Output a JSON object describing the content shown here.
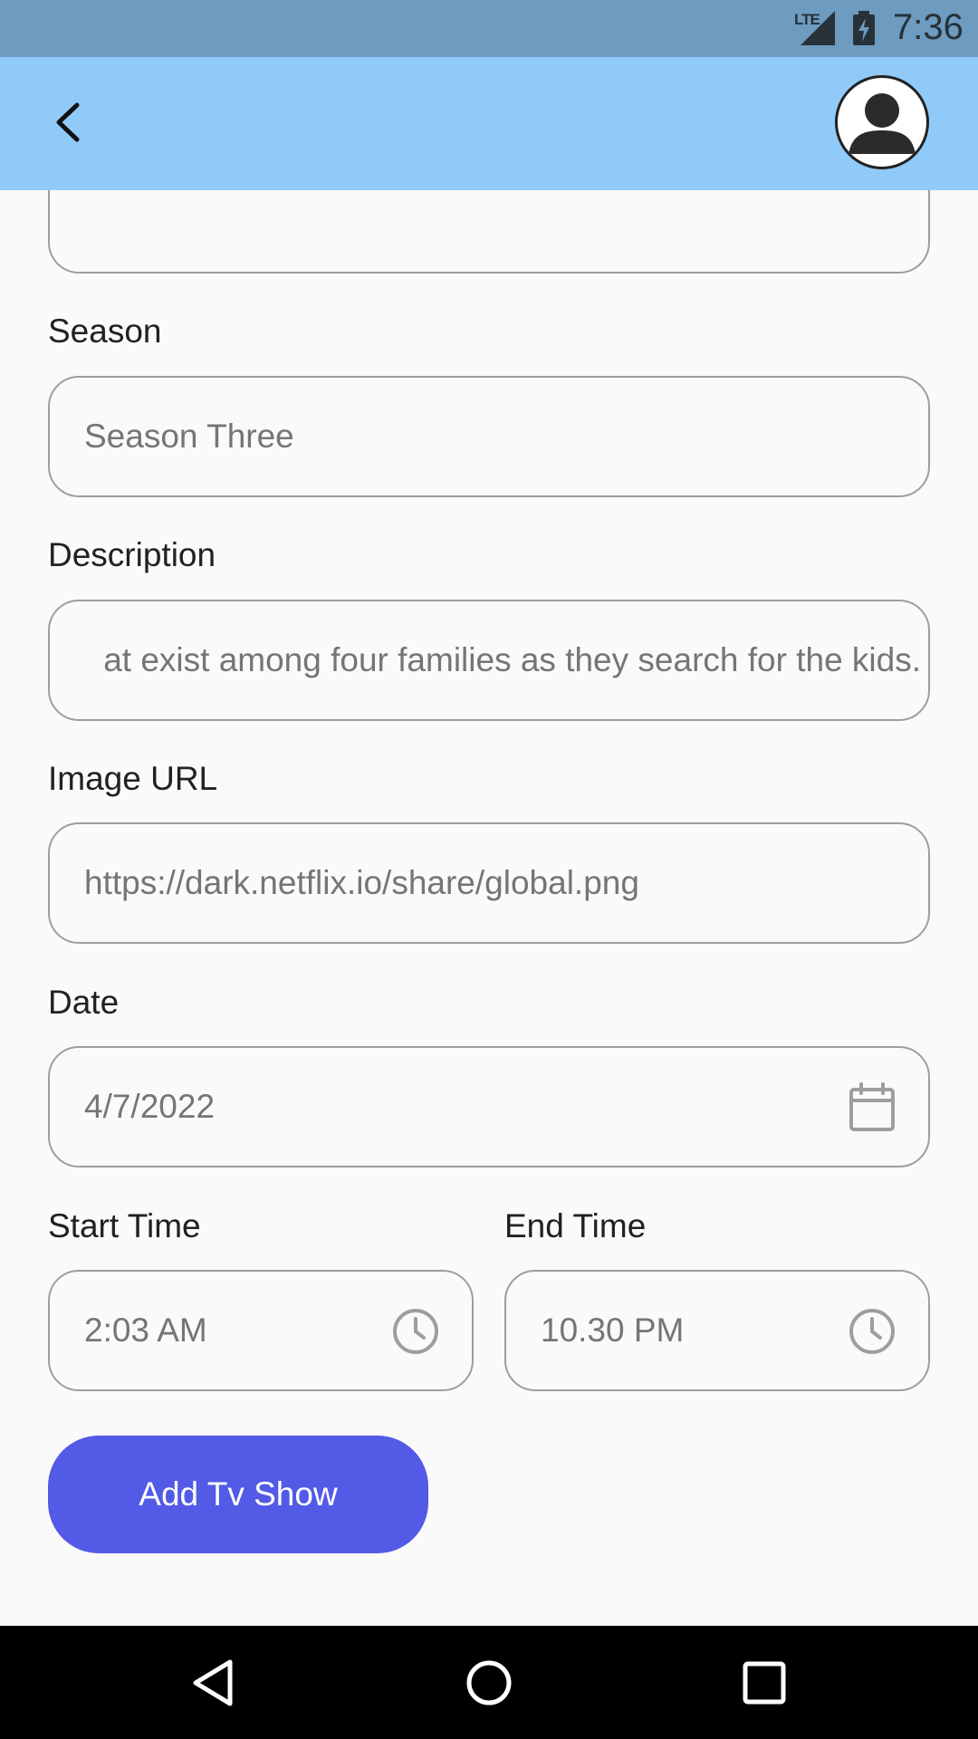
{
  "status_bar": {
    "network": "LTE",
    "time": "7:36"
  },
  "app_bar": {
    "back_icon": "chevron-left-icon",
    "avatar_icon": "account-circle-icon"
  },
  "form": {
    "season": {
      "label": "Season",
      "value": "Season Three"
    },
    "description": {
      "label": "Description",
      "value": "at exist among four families as they search for the kids."
    },
    "image_url": {
      "label": "Image URL",
      "value": "https://dark.netflix.io/share/global.png"
    },
    "date": {
      "label": "Date",
      "value": "4/7/2022",
      "icon": "calendar-icon"
    },
    "start_time": {
      "label": "Start Time",
      "value": "2:03 AM",
      "icon": "clock-icon"
    },
    "end_time": {
      "label": "End Time",
      "value": "10.30 PM",
      "icon": "clock-icon"
    },
    "submit_label": "Add Tv Show"
  },
  "colors": {
    "status_bar": "#6e9bc0",
    "app_bar": "#90caf9",
    "primary_button": "#535ae6",
    "field_border": "#9e9e9e"
  }
}
